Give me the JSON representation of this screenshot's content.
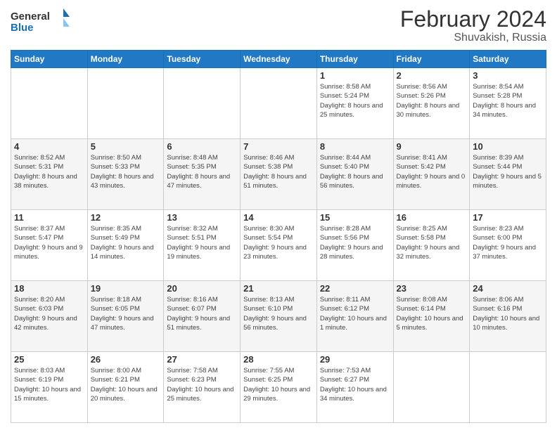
{
  "logo": {
    "general": "General",
    "blue": "Blue"
  },
  "header": {
    "month_year": "February 2024",
    "location": "Shuvakish, Russia"
  },
  "days_of_week": [
    "Sunday",
    "Monday",
    "Tuesday",
    "Wednesday",
    "Thursday",
    "Friday",
    "Saturday"
  ],
  "weeks": [
    [
      {
        "day": "",
        "info": ""
      },
      {
        "day": "",
        "info": ""
      },
      {
        "day": "",
        "info": ""
      },
      {
        "day": "",
        "info": ""
      },
      {
        "day": "1",
        "info": "Sunrise: 8:58 AM\nSunset: 5:24 PM\nDaylight: 8 hours\nand 25 minutes."
      },
      {
        "day": "2",
        "info": "Sunrise: 8:56 AM\nSunset: 5:26 PM\nDaylight: 8 hours\nand 30 minutes."
      },
      {
        "day": "3",
        "info": "Sunrise: 8:54 AM\nSunset: 5:28 PM\nDaylight: 8 hours\nand 34 minutes."
      }
    ],
    [
      {
        "day": "4",
        "info": "Sunrise: 8:52 AM\nSunset: 5:31 PM\nDaylight: 8 hours\nand 38 minutes."
      },
      {
        "day": "5",
        "info": "Sunrise: 8:50 AM\nSunset: 5:33 PM\nDaylight: 8 hours\nand 43 minutes."
      },
      {
        "day": "6",
        "info": "Sunrise: 8:48 AM\nSunset: 5:35 PM\nDaylight: 8 hours\nand 47 minutes."
      },
      {
        "day": "7",
        "info": "Sunrise: 8:46 AM\nSunset: 5:38 PM\nDaylight: 8 hours\nand 51 minutes."
      },
      {
        "day": "8",
        "info": "Sunrise: 8:44 AM\nSunset: 5:40 PM\nDaylight: 8 hours\nand 56 minutes."
      },
      {
        "day": "9",
        "info": "Sunrise: 8:41 AM\nSunset: 5:42 PM\nDaylight: 9 hours\nand 0 minutes."
      },
      {
        "day": "10",
        "info": "Sunrise: 8:39 AM\nSunset: 5:44 PM\nDaylight: 9 hours\nand 5 minutes."
      }
    ],
    [
      {
        "day": "11",
        "info": "Sunrise: 8:37 AM\nSunset: 5:47 PM\nDaylight: 9 hours\nand 9 minutes."
      },
      {
        "day": "12",
        "info": "Sunrise: 8:35 AM\nSunset: 5:49 PM\nDaylight: 9 hours\nand 14 minutes."
      },
      {
        "day": "13",
        "info": "Sunrise: 8:32 AM\nSunset: 5:51 PM\nDaylight: 9 hours\nand 19 minutes."
      },
      {
        "day": "14",
        "info": "Sunrise: 8:30 AM\nSunset: 5:54 PM\nDaylight: 9 hours\nand 23 minutes."
      },
      {
        "day": "15",
        "info": "Sunrise: 8:28 AM\nSunset: 5:56 PM\nDaylight: 9 hours\nand 28 minutes."
      },
      {
        "day": "16",
        "info": "Sunrise: 8:25 AM\nSunset: 5:58 PM\nDaylight: 9 hours\nand 32 minutes."
      },
      {
        "day": "17",
        "info": "Sunrise: 8:23 AM\nSunset: 6:00 PM\nDaylight: 9 hours\nand 37 minutes."
      }
    ],
    [
      {
        "day": "18",
        "info": "Sunrise: 8:20 AM\nSunset: 6:03 PM\nDaylight: 9 hours\nand 42 minutes."
      },
      {
        "day": "19",
        "info": "Sunrise: 8:18 AM\nSunset: 6:05 PM\nDaylight: 9 hours\nand 47 minutes."
      },
      {
        "day": "20",
        "info": "Sunrise: 8:16 AM\nSunset: 6:07 PM\nDaylight: 9 hours\nand 51 minutes."
      },
      {
        "day": "21",
        "info": "Sunrise: 8:13 AM\nSunset: 6:10 PM\nDaylight: 9 hours\nand 56 minutes."
      },
      {
        "day": "22",
        "info": "Sunrise: 8:11 AM\nSunset: 6:12 PM\nDaylight: 10 hours\nand 1 minute."
      },
      {
        "day": "23",
        "info": "Sunrise: 8:08 AM\nSunset: 6:14 PM\nDaylight: 10 hours\nand 5 minutes."
      },
      {
        "day": "24",
        "info": "Sunrise: 8:06 AM\nSunset: 6:16 PM\nDaylight: 10 hours\nand 10 minutes."
      }
    ],
    [
      {
        "day": "25",
        "info": "Sunrise: 8:03 AM\nSunset: 6:19 PM\nDaylight: 10 hours\nand 15 minutes."
      },
      {
        "day": "26",
        "info": "Sunrise: 8:00 AM\nSunset: 6:21 PM\nDaylight: 10 hours\nand 20 minutes."
      },
      {
        "day": "27",
        "info": "Sunrise: 7:58 AM\nSunset: 6:23 PM\nDaylight: 10 hours\nand 25 minutes."
      },
      {
        "day": "28",
        "info": "Sunrise: 7:55 AM\nSunset: 6:25 PM\nDaylight: 10 hours\nand 29 minutes."
      },
      {
        "day": "29",
        "info": "Sunrise: 7:53 AM\nSunset: 6:27 PM\nDaylight: 10 hours\nand 34 minutes."
      },
      {
        "day": "",
        "info": ""
      },
      {
        "day": "",
        "info": ""
      }
    ]
  ]
}
